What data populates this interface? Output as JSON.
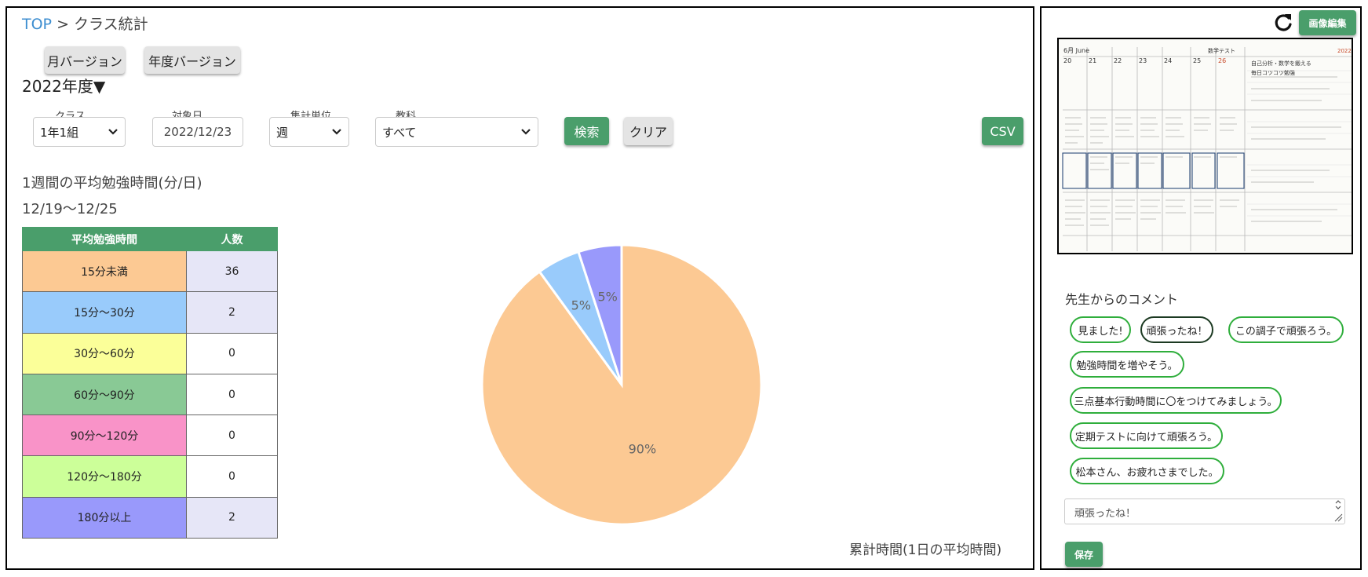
{
  "breadcrumb": {
    "top": "TOP",
    "separator": ">",
    "current": "クラス統計"
  },
  "buttons": {
    "monthly": "月バージョン",
    "yearly": "年度バージョン",
    "search": "検索",
    "clear": "クリア",
    "csv": "CSV"
  },
  "year_selector": "2022年度▼",
  "filters": {
    "class": {
      "label": "クラス",
      "value": "1年1組"
    },
    "date": {
      "label": "対象日",
      "value": "2022/12/23"
    },
    "unit": {
      "label": "集計単位",
      "value": "週"
    },
    "subject": {
      "label": "教科",
      "value": "すべて"
    }
  },
  "stats": {
    "title": "1週間の平均勉強時間(分/日)",
    "range": "12/19～12/25",
    "headers": [
      "平均勉強時間",
      "人数"
    ],
    "rows": [
      {
        "label": "15分未満",
        "count": "36",
        "color": "#fcc993"
      },
      {
        "label": "15分～30分",
        "count": "2",
        "color": "#99cbfb"
      },
      {
        "label": "30分～60分",
        "count": "0",
        "color": "#fbff99"
      },
      {
        "label": "60分～90分",
        "count": "0",
        "color": "#89c995"
      },
      {
        "label": "90分～120分",
        "count": "0",
        "color": "#f993c8"
      },
      {
        "label": "120分～180分",
        "count": "0",
        "color": "#ccff99"
      },
      {
        "label": "180分以上",
        "count": "2",
        "color": "#9999fb"
      }
    ]
  },
  "chart_data": {
    "type": "pie",
    "title": "",
    "caption": "累計時間(1日の平均時間)",
    "slices": [
      {
        "name": "15分未満",
        "value": 36,
        "percent_label": "90%",
        "color": "#fcc993"
      },
      {
        "name": "15分～30分",
        "value": 2,
        "percent_label": "5%",
        "color": "#99cbfb"
      },
      {
        "name": "180分以上",
        "value": 2,
        "percent_label": "5%",
        "color": "#9999fb"
      }
    ]
  },
  "right_panel": {
    "edit_button": "画像編集",
    "refresh_icon": "refresh-icon",
    "comment_title": "先生からのコメント",
    "chips": [
      {
        "label": "見ました!",
        "active": false
      },
      {
        "label": "頑張ったね！",
        "active": true
      },
      {
        "label": "この調子で頑張ろう。",
        "active": false
      },
      {
        "label": "勉強時間を増やそう。",
        "active": false
      },
      {
        "label": "三点基本行動時間に〇をつけてみましょう。",
        "active": false
      },
      {
        "label": "定期テストに向けて頑張ろう。",
        "active": false
      },
      {
        "label": "松本さん、お疲れさまでした。",
        "active": false
      }
    ],
    "comment_value": "頑張ったね！",
    "save_button": "保存"
  },
  "notebook": {
    "month_label": "6月 June",
    "days": [
      "20",
      "21",
      "22",
      "23",
      "24",
      "25",
      "26"
    ],
    "title": "数学テスト",
    "note_line1": "自己分析・数学を鍛える",
    "note_line2": "毎日コツコツ勉強",
    "year_mark": "2022"
  },
  "colors": {
    "accent_green": "#4a9e6b",
    "chip_border": "#2fae3c",
    "link_blue": "#3d8ed0"
  }
}
